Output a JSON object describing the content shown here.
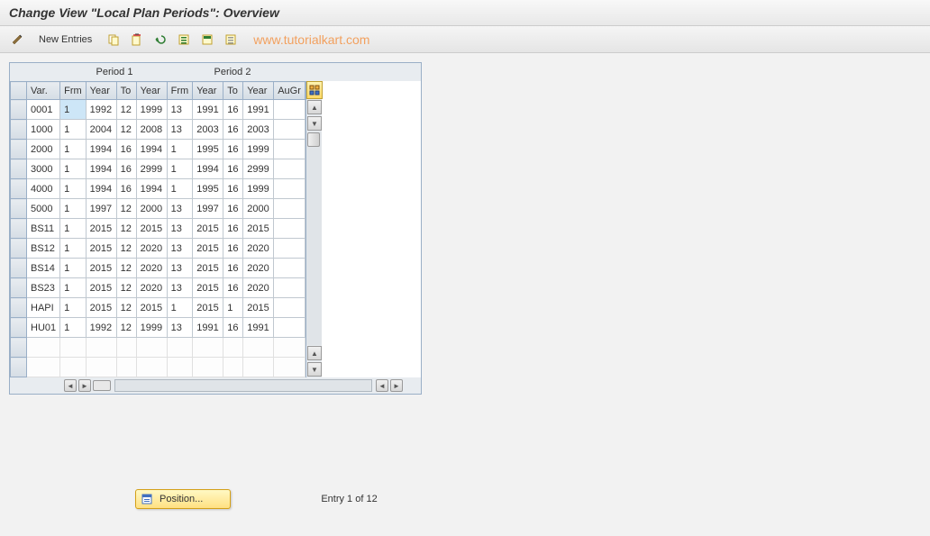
{
  "title": "Change View \"Local Plan Periods\": Overview",
  "toolbar": {
    "new_entries": "New Entries"
  },
  "watermark": "www.tutorialkart.com",
  "group_headers": {
    "period1": "Period 1",
    "period2": "Period 2"
  },
  "columns": {
    "var": "Var.",
    "frm1": "Frm",
    "year1": "Year",
    "to1": "To",
    "year2": "Year",
    "frm2": "Frm",
    "year3": "Year",
    "to2": "To",
    "year4": "Year",
    "augr": "AuGr"
  },
  "rows": [
    {
      "var": "0001",
      "frm1": "1",
      "year1": "1992",
      "to1": "12",
      "year2": "1999",
      "frm2": "13",
      "year3": "1991",
      "to2": "16",
      "year4": "1991",
      "augr": ""
    },
    {
      "var": "1000",
      "frm1": "1",
      "year1": "2004",
      "to1": "12",
      "year2": "2008",
      "frm2": "13",
      "year3": "2003",
      "to2": "16",
      "year4": "2003",
      "augr": ""
    },
    {
      "var": "2000",
      "frm1": "1",
      "year1": "1994",
      "to1": "16",
      "year2": "1994",
      "frm2": "1",
      "year3": "1995",
      "to2": "16",
      "year4": "1999",
      "augr": ""
    },
    {
      "var": "3000",
      "frm1": "1",
      "year1": "1994",
      "to1": "16",
      "year2": "2999",
      "frm2": "1",
      "year3": "1994",
      "to2": "16",
      "year4": "2999",
      "augr": ""
    },
    {
      "var": "4000",
      "frm1": "1",
      "year1": "1994",
      "to1": "16",
      "year2": "1994",
      "frm2": "1",
      "year3": "1995",
      "to2": "16",
      "year4": "1999",
      "augr": ""
    },
    {
      "var": "5000",
      "frm1": "1",
      "year1": "1997",
      "to1": "12",
      "year2": "2000",
      "frm2": "13",
      "year3": "1997",
      "to2": "16",
      "year4": "2000",
      "augr": ""
    },
    {
      "var": "BS11",
      "frm1": "1",
      "year1": "2015",
      "to1": "12",
      "year2": "2015",
      "frm2": "13",
      "year3": "2015",
      "to2": "16",
      "year4": "2015",
      "augr": ""
    },
    {
      "var": "BS12",
      "frm1": "1",
      "year1": "2015",
      "to1": "12",
      "year2": "2020",
      "frm2": "13",
      "year3": "2015",
      "to2": "16",
      "year4": "2020",
      "augr": ""
    },
    {
      "var": "BS14",
      "frm1": "1",
      "year1": "2015",
      "to1": "12",
      "year2": "2020",
      "frm2": "13",
      "year3": "2015",
      "to2": "16",
      "year4": "2020",
      "augr": ""
    },
    {
      "var": "BS23",
      "frm1": "1",
      "year1": "2015",
      "to1": "12",
      "year2": "2020",
      "frm2": "13",
      "year3": "2015",
      "to2": "16",
      "year4": "2020",
      "augr": ""
    },
    {
      "var": "HAPI",
      "frm1": "1",
      "year1": "2015",
      "to1": "12",
      "year2": "2015",
      "frm2": "1",
      "year3": "2015",
      "to2": "1",
      "year4": "2015",
      "augr": ""
    },
    {
      "var": "HU01",
      "frm1": "1",
      "year1": "1992",
      "to1": "12",
      "year2": "1999",
      "frm2": "13",
      "year3": "1991",
      "to2": "16",
      "year4": "1991",
      "augr": ""
    }
  ],
  "position_button": "Position...",
  "entry_status": "Entry 1 of 12"
}
